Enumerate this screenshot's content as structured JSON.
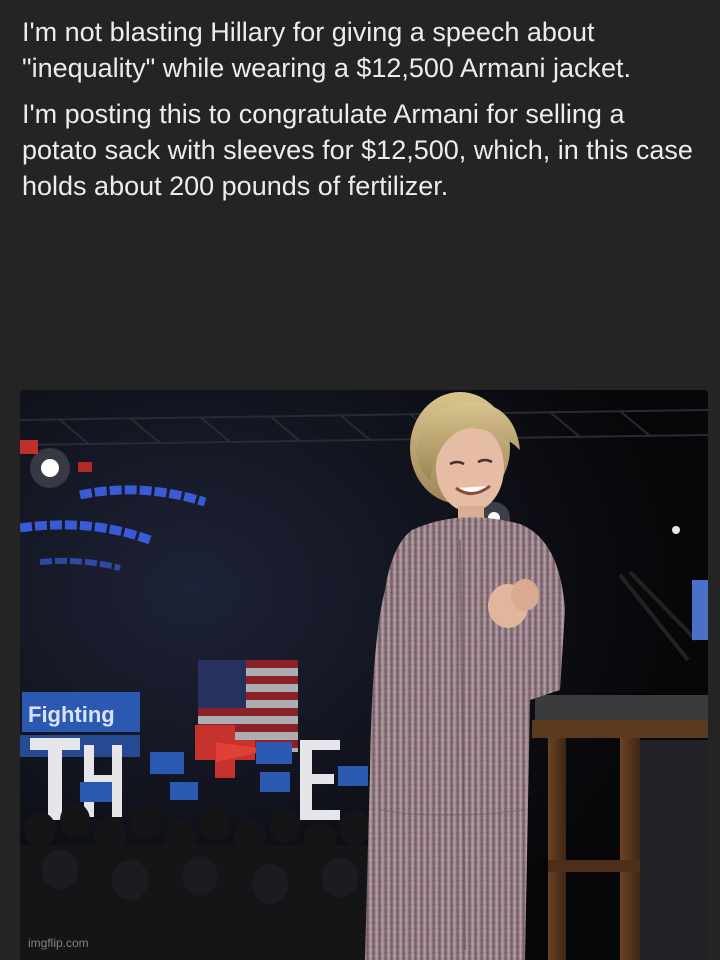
{
  "post": {
    "paragraph_1": "I'm not blasting Hillary for giving a speech about \"inequality\" while wearing a $12,500 Armani jacket.",
    "paragraph_2": "I'm posting this to congratulate Armani for selling a potato sack with sleeves for $12,500, which, in this case holds about 200 pounds of fertilizer."
  },
  "photo": {
    "crowd_sign_text": "Fighting",
    "watermark": "imgflip.com"
  },
  "colors": {
    "background": "#242424",
    "text": "#ececec",
    "jacket": "#a48a92",
    "stage_blue": "#3a5bd8"
  }
}
